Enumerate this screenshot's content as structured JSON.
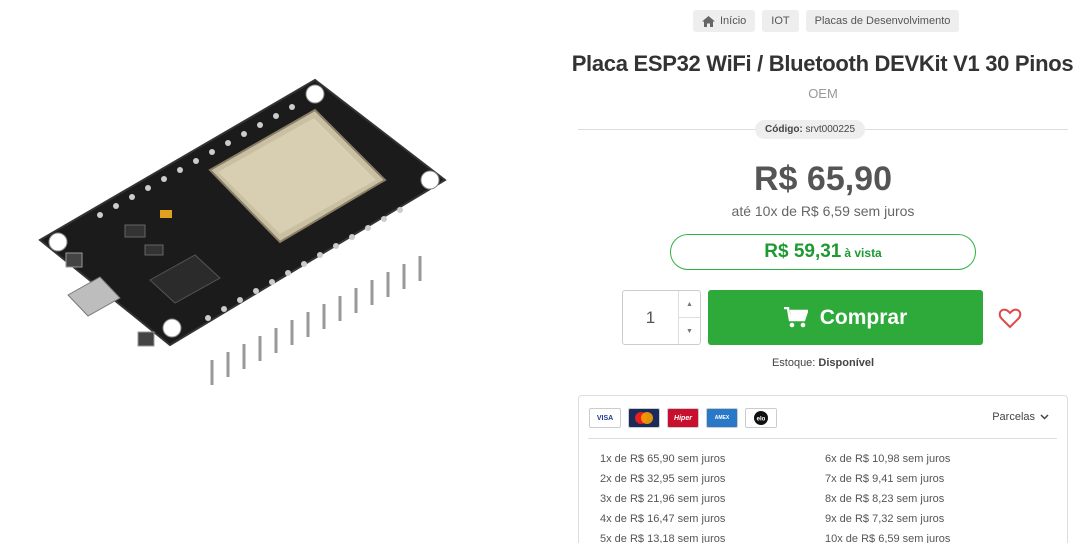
{
  "breadcrumb": [
    {
      "label": "Início",
      "icon": "home-icon"
    },
    {
      "label": "IOT"
    },
    {
      "label": "Placas de Desenvolvimento"
    }
  ],
  "product": {
    "title": "Placa ESP32 WiFi / Bluetooth DEVKit V1 30 Pinos",
    "brand": "OEM",
    "sku_label": "Código:",
    "sku_value": "srvt000225",
    "price": "R$ 65,90",
    "installments": "até 10x de R$ 6,59 sem juros",
    "cash_price": "R$ 59,31",
    "cash_label": "à vista",
    "quantity": "1",
    "buy_label": "Comprar",
    "stock_label": "Estoque:",
    "stock_value": "Disponível"
  },
  "payment": {
    "cards": [
      "visa",
      "mastercard",
      "hipercard",
      "american-express",
      "elo"
    ],
    "parcelas_label": "Parcelas",
    "plans_left": [
      "1x de R$ 65,90 sem juros",
      "2x de R$ 32,95 sem juros",
      "3x de R$ 21,96 sem juros",
      "4x de R$ 16,47 sem juros",
      "5x de R$ 13,18 sem juros"
    ],
    "plans_right": [
      "6x de R$ 10,98 sem juros",
      "7x de R$ 9,41 sem juros",
      "8x de R$ 8,23 sem juros",
      "9x de R$ 7,32 sem juros",
      "10x de R$ 6,59 sem juros"
    ]
  },
  "colors": {
    "buy_button": "#2daa3a",
    "cash_price": "#1f9a33",
    "favorite": "#e04848"
  }
}
